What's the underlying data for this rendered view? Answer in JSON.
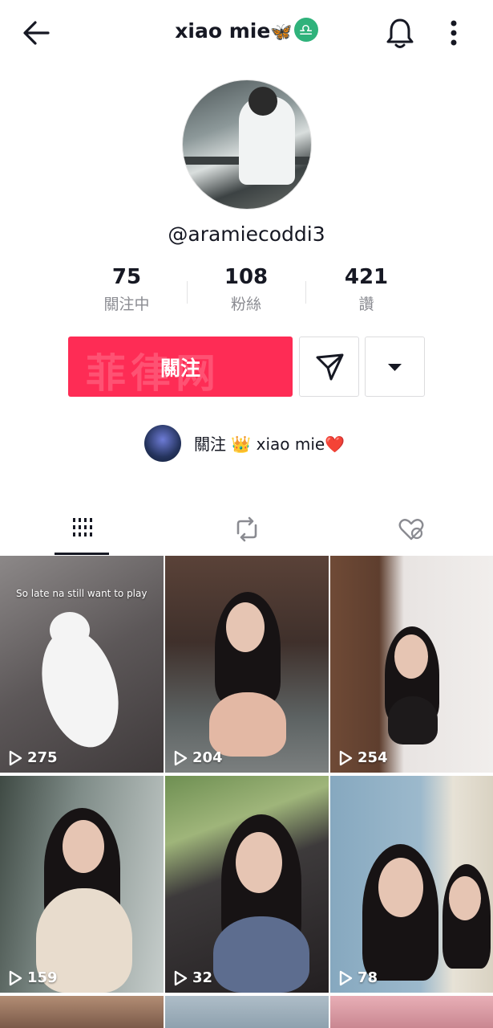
{
  "header": {
    "title": "xiao mie",
    "title_emoji": "🦋",
    "zodiac_badge": "♎",
    "back_icon": "arrow-left-icon",
    "bell_icon": "bell-icon",
    "more_icon": "more-vertical-icon"
  },
  "profile": {
    "handle": "@aramiecoddi3",
    "stats": [
      {
        "value": "75",
        "label": "關注中"
      },
      {
        "value": "108",
        "label": "粉絲"
      },
      {
        "value": "421",
        "label": "讚"
      }
    ]
  },
  "actions": {
    "follow_label": "關注",
    "follow_watermark": "菲律网",
    "follow_color": "#fe2c55",
    "message_icon": "send-icon",
    "dropdown_icon": "triangle-down-icon"
  },
  "suggested": {
    "text": "關注 👑 xiao mie❤️"
  },
  "tabs": [
    {
      "icon": "grid-icon",
      "active": true
    },
    {
      "icon": "repost-icon",
      "active": false
    },
    {
      "icon": "liked-hidden-icon",
      "active": false
    }
  ],
  "videos": [
    {
      "views": "275",
      "caption": "So late na still want to play"
    },
    {
      "views": "204"
    },
    {
      "views": "254"
    },
    {
      "views": "159"
    },
    {
      "views": "32"
    },
    {
      "views": "78"
    }
  ]
}
